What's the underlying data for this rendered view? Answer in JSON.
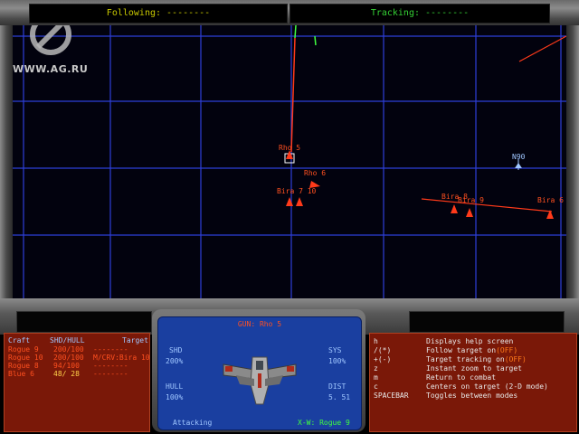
{
  "top_bar": {
    "following": "Following: --------",
    "tracking": "Tracking: --------"
  },
  "watermark": {
    "site": "WWW.AG.RU"
  },
  "map": {
    "labels": [
      {
        "id": "rho5",
        "text": "Rho 5"
      },
      {
        "id": "rho6",
        "text": "Rho 6"
      },
      {
        "id": "bira710",
        "text": "Bira 7 10"
      },
      {
        "id": "bira8",
        "text": "Bira 8"
      },
      {
        "id": "bira9",
        "text": "Bira 9"
      },
      {
        "id": "bira6",
        "text": "Bira 6"
      },
      {
        "id": "n90",
        "text": "N90"
      }
    ]
  },
  "craft_table": {
    "headers": {
      "craft": "Craft",
      "shd_hull": "SHD/HULL",
      "target": "Target"
    },
    "rows": [
      {
        "craft": "Rogue 9",
        "stats": "200/100",
        "target": "--------"
      },
      {
        "craft": "Rogue 10",
        "stats": "200/100",
        "target": "M/CRV:Bira 10"
      },
      {
        "craft": "Rogue 8",
        "stats": "94/100",
        "target": "--------"
      },
      {
        "craft": "Blue 6",
        "stats": "48/ 28",
        "target": "--------"
      }
    ]
  },
  "target_display": {
    "gun": "GUN: Rho 5",
    "shd_label": "SHD",
    "shd_value": "200%",
    "hull_label": "HULL",
    "hull_value": "100%",
    "sys_label": "SYS",
    "sys_value": "100%",
    "dist_label": "DIST",
    "dist_value": "5. 51",
    "status": "Attacking",
    "craft": "X-W: Rogue 9"
  },
  "help": {
    "rows": [
      {
        "key": "h",
        "desc": "Displays help screen",
        "off": ""
      },
      {
        "key": "/(*)",
        "desc": "Follow target on",
        "off": "(OFF)"
      },
      {
        "key": "+(-)",
        "desc": "Target tracking on",
        "off": "(OFF)"
      },
      {
        "key": "z",
        "desc": "Instant zoom to target",
        "off": ""
      },
      {
        "key": "m",
        "desc": "Return to combat",
        "off": ""
      },
      {
        "key": "c",
        "desc": "Centers on target (2-D mode)",
        "off": ""
      },
      {
        "key": "SPACEBAR",
        "desc": "Toggles between modes",
        "off": ""
      }
    ]
  },
  "colors": {
    "grid": "#2d3fd8",
    "enemy": "#ff3a1a",
    "friendly": "#9fc6ff",
    "panel": "#7a1808"
  }
}
